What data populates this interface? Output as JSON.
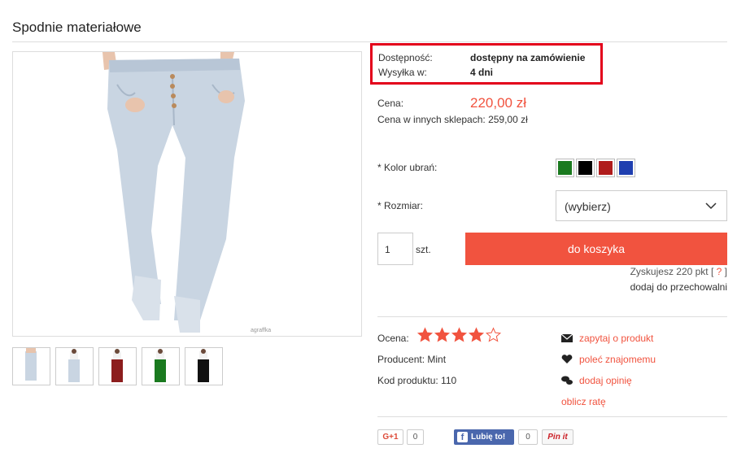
{
  "product": {
    "title": "Spodnie materiałowe",
    "image_watermark": "agraffka"
  },
  "availability": {
    "label": "Dostępność:",
    "value": "dostępny na zamówienie",
    "shipping_label": "Wysyłka w:",
    "shipping_value": "4 dni"
  },
  "price": {
    "label": "Cena:",
    "value": "220,00 zł",
    "other_shops": "Cena w innych sklepach:  259,00 zł"
  },
  "options": {
    "color_label": "* Kolor ubrań:",
    "colors": [
      "#1a7a1f",
      "#000000",
      "#b01c1c",
      "#1f3fb0"
    ],
    "size_label": "* Rozmiar:",
    "size_value": "(wybierz)"
  },
  "cart": {
    "qty_value": "1",
    "qty_unit": "szt.",
    "button": "do koszyka",
    "points": "Zyskujesz 220 pkt [ ",
    "points_help": "?",
    "points_end": " ]",
    "storage": "dodaj do przechowalni"
  },
  "details": {
    "rating_label": "Ocena:",
    "rating": 4,
    "rating_max": 5,
    "producer": "Producent:  Mint",
    "code": "Kod produktu:  110"
  },
  "actions": {
    "ask": "zapytaj o produkt",
    "recommend": "poleć znajomemu",
    "review": "dodaj opinię",
    "installment": "oblicz ratę"
  },
  "social": {
    "gplus": "G+1",
    "gplus_count": "0",
    "fb": "Lubię to!",
    "fb_count": "0",
    "pin": "Pin it"
  },
  "colors": {
    "accent": "#f1533f",
    "highlight_border": "#e3001b"
  }
}
